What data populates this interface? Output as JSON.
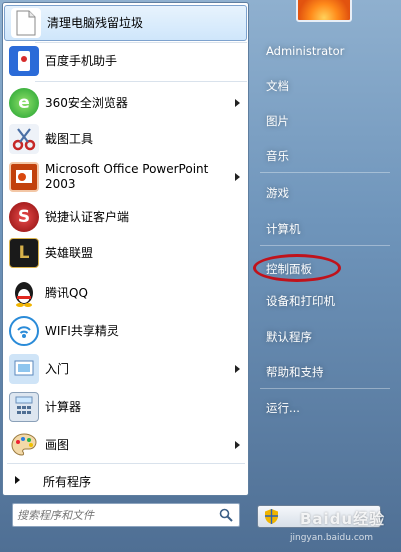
{
  "left_items": [
    {
      "label": "清理电脑残留垃圾",
      "icon": "document-icon",
      "arrow": false
    },
    {
      "label": "百度手机助手",
      "icon": "baidu-phone-assistant-icon",
      "arrow": false
    },
    {
      "label": "360安全浏览器",
      "icon": "browser-360-icon",
      "arrow": true
    },
    {
      "label": "截图工具",
      "icon": "scissors-icon",
      "arrow": false
    },
    {
      "label": "Microsoft Office PowerPoint 2003",
      "icon": "powerpoint-icon",
      "arrow": true
    },
    {
      "label": "锐捷认证客户端",
      "icon": "ruijie-client-icon",
      "arrow": false
    },
    {
      "label": "英雄联盟",
      "icon": "league-of-legends-icon",
      "arrow": false
    },
    {
      "label": "腾讯QQ",
      "icon": "qq-penguin-icon",
      "arrow": false
    },
    {
      "label": "WIFI共享精灵",
      "icon": "wifi-sharing-icon",
      "arrow": false
    },
    {
      "label": "入门",
      "icon": "getting-started-icon",
      "arrow": true
    },
    {
      "label": "计算器",
      "icon": "calculator-icon",
      "arrow": false
    },
    {
      "label": "画图",
      "icon": "paint-palette-icon",
      "arrow": true
    }
  ],
  "all_programs": "所有程序",
  "search": {
    "placeholder": "搜索程序和文件"
  },
  "right_items": {
    "user": "Administrator",
    "documents": "文档",
    "pictures": "图片",
    "music": "音乐",
    "games": "游戏",
    "computer": "计算机",
    "control_panel": "控制面板",
    "devices_printers": "设备和打印机",
    "default_programs": "默认程序",
    "help_support": "帮助和支持",
    "run": "运行..."
  },
  "watermark": {
    "main": "Baidu经验",
    "sub": "jingyan.baidu.com"
  },
  "colors": {
    "highlight_ellipse": "#c0121b",
    "hover_blue": "#cfe6fb"
  }
}
